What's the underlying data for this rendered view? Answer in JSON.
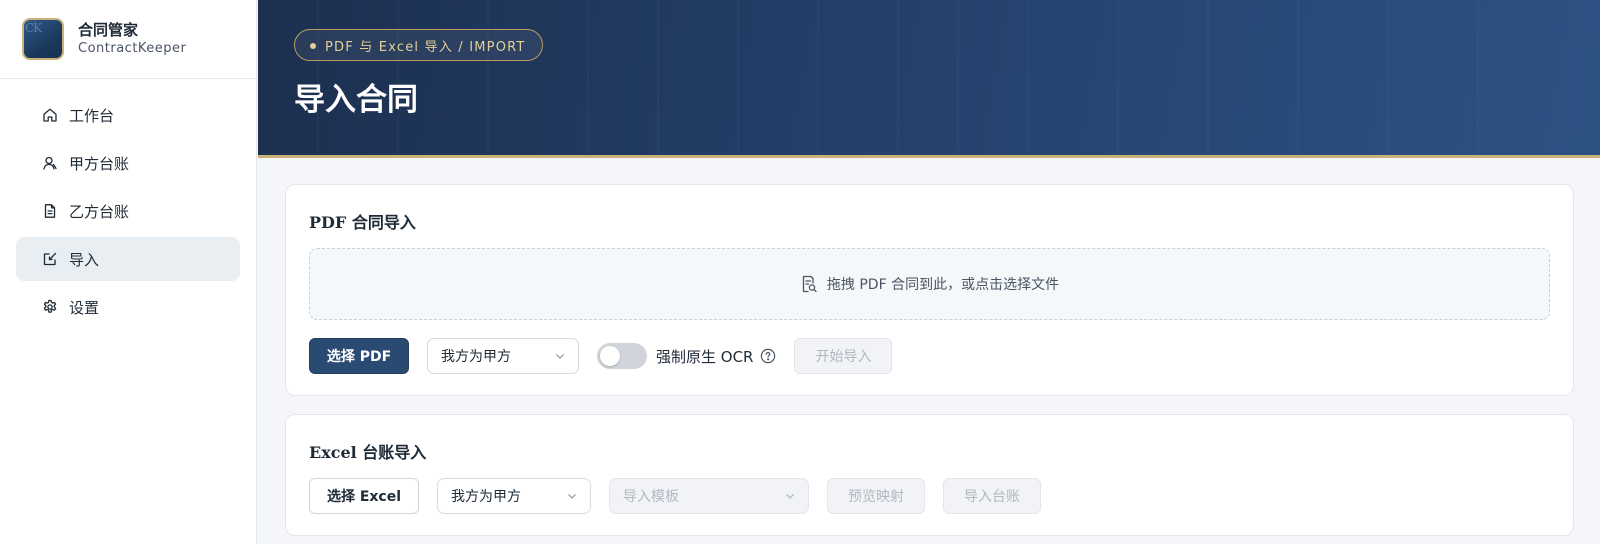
{
  "brand": {
    "logo_text": "CK",
    "title": "合同管家",
    "subtitle": "ContractKeeper"
  },
  "sidebar": {
    "items": [
      {
        "label": "工作台",
        "icon": "home-icon",
        "active": false
      },
      {
        "label": "甲方台账",
        "icon": "user-icon",
        "active": false
      },
      {
        "label": "乙方台账",
        "icon": "document-icon",
        "active": false
      },
      {
        "label": "导入",
        "icon": "import-icon",
        "active": true
      },
      {
        "label": "设置",
        "icon": "gear-icon",
        "active": false
      }
    ]
  },
  "header": {
    "badge": "PDF 与 Excel 导入 / IMPORT",
    "title": "导入合同"
  },
  "pdf_import": {
    "title": "PDF 合同导入",
    "dropzone_text": "拖拽 PDF 合同到此，或点击选择文件",
    "select_button": "选择 PDF",
    "party_select": "我方为甲方",
    "ocr_toggle_label": "强制原生 OCR",
    "ocr_enabled": false,
    "start_button": "开始导入"
  },
  "excel_import": {
    "title": "Excel 台账导入",
    "select_button": "选择 Excel",
    "party_select": "我方为甲方",
    "template_placeholder": "导入模板",
    "preview_button": "预览映射",
    "import_button": "导入台账"
  },
  "colors": {
    "primary": "#2a4a72",
    "header_dark": "#1c2f4f",
    "accent_gold": "#c9b27a",
    "active_nav_bg": "#e9eef3"
  }
}
